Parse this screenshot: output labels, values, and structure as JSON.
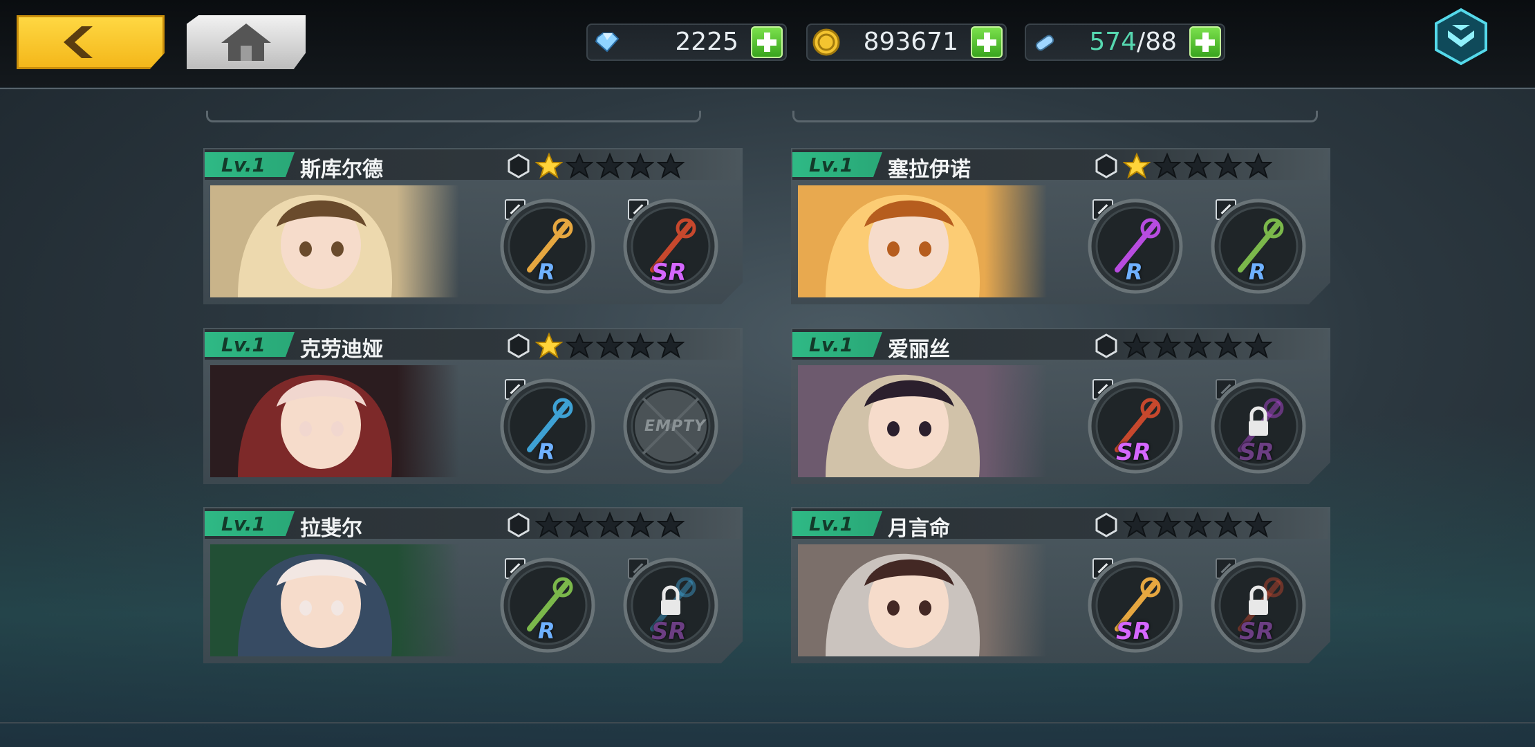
{
  "topbar": {
    "back_icon": "chevron-left-icon",
    "home_icon": "home-icon",
    "menu_icon": "chevron-down-menu-icon",
    "resources": [
      {
        "icon": "diamond-icon",
        "value": "2225"
      },
      {
        "icon": "gold-coin-icon",
        "value": "893671"
      },
      {
        "icon": "stamina-icon",
        "current": "574",
        "separator": "/",
        "max": "88"
      }
    ]
  },
  "colors": {
    "level_badge": "#2fb985",
    "star_filled": "#ffd43a",
    "star_empty": "#1c2227",
    "rarity_r": "#6fb1ff",
    "rarity_sr": "#d567ff",
    "plus_button": "#4cc22a"
  },
  "characters": [
    {
      "level": "Lv.1",
      "name": "斯库尔德",
      "stars_filled": 1,
      "stars_total": 5,
      "weapons": [
        {
          "rarity": "R",
          "state": "equipped"
        },
        {
          "rarity": "SR",
          "state": "equipped"
        }
      ]
    },
    {
      "level": "Lv.1",
      "name": "塞拉伊诺",
      "stars_filled": 1,
      "stars_total": 5,
      "weapons": [
        {
          "rarity": "R",
          "state": "equipped"
        },
        {
          "rarity": "R",
          "state": "equipped"
        }
      ]
    },
    {
      "level": "Lv.1",
      "name": "克劳迪娅",
      "stars_filled": 1,
      "stars_total": 5,
      "weapons": [
        {
          "rarity": "R",
          "state": "equipped"
        },
        {
          "rarity": "",
          "state": "empty",
          "label": "EMPTY"
        }
      ]
    },
    {
      "level": "Lv.1",
      "name": "爱丽丝",
      "stars_filled": 0,
      "stars_total": 5,
      "weapons": [
        {
          "rarity": "SR",
          "state": "equipped"
        },
        {
          "rarity": "SR",
          "state": "locked"
        }
      ]
    },
    {
      "level": "Lv.1",
      "name": "拉斐尔",
      "stars_filled": 0,
      "stars_total": 5,
      "weapons": [
        {
          "rarity": "R",
          "state": "equipped"
        },
        {
          "rarity": "SR",
          "state": "locked"
        }
      ]
    },
    {
      "level": "Lv.1",
      "name": "月言命",
      "stars_filled": 0,
      "stars_total": 5,
      "weapons": [
        {
          "rarity": "SR",
          "state": "equipped"
        },
        {
          "rarity": "SR",
          "state": "locked"
        }
      ]
    }
  ]
}
